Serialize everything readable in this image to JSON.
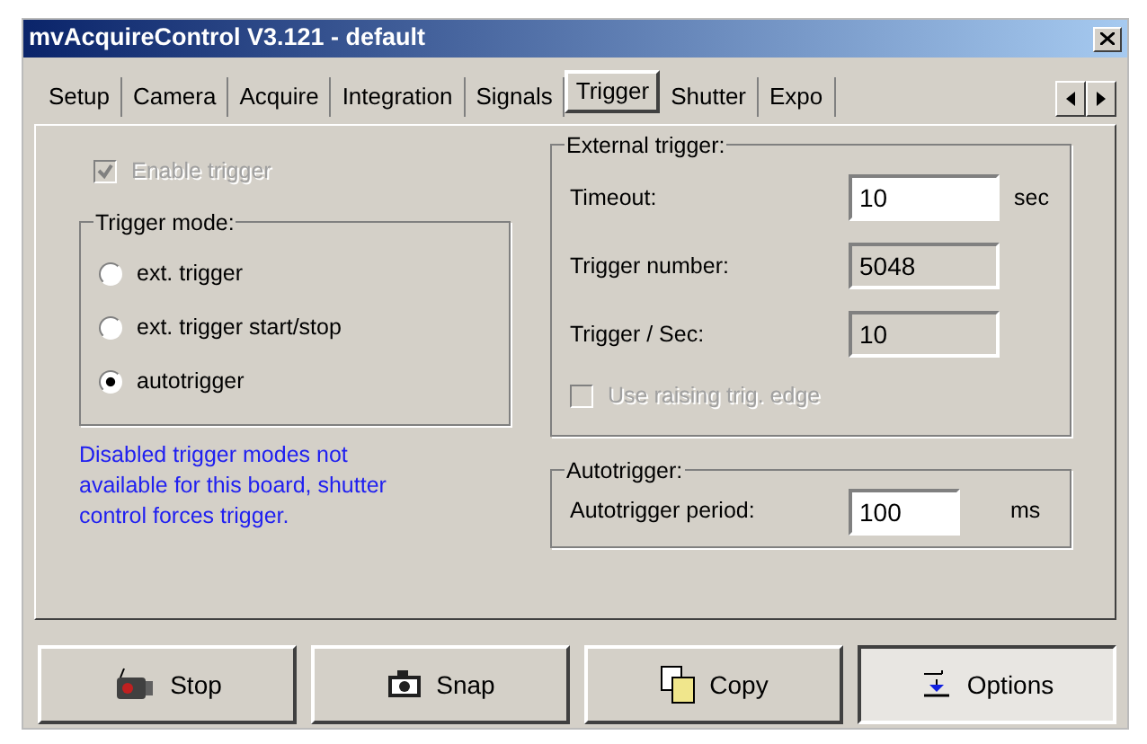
{
  "window": {
    "title": "mvAcquireControl  V3.121 - default"
  },
  "tabs": [
    {
      "label": "Setup",
      "selected": false
    },
    {
      "label": "Camera",
      "selected": false
    },
    {
      "label": "Acquire",
      "selected": false
    },
    {
      "label": "Integration",
      "selected": false
    },
    {
      "label": "Signals",
      "selected": false
    },
    {
      "label": "Trigger",
      "selected": true
    },
    {
      "label": "Shutter",
      "selected": false
    },
    {
      "label": "Expo",
      "selected": false
    }
  ],
  "enable_trigger": {
    "label": "Enable trigger",
    "checked": true,
    "disabled": true
  },
  "trigger_mode": {
    "title": "Trigger mode:",
    "options": [
      {
        "label": "ext. trigger",
        "selected": false
      },
      {
        "label": "ext. trigger start/stop",
        "selected": false
      },
      {
        "label": "autotrigger",
        "selected": true
      }
    ]
  },
  "note": "Disabled trigger modes not available for this board, shutter control forces trigger.",
  "external_trigger": {
    "title": "External trigger:",
    "fields": [
      {
        "label": "Timeout:",
        "value": "10",
        "unit": "sec",
        "disabled": false
      },
      {
        "label": "Trigger number:",
        "value": "5048",
        "disabled": true
      },
      {
        "label": "Trigger / Sec:",
        "value": "10",
        "disabled": true
      }
    ],
    "raising_edge": {
      "label": "Use raising trig. edge",
      "checked": false,
      "disabled": true
    }
  },
  "autotrigger": {
    "title": "Autotrigger:",
    "field": {
      "label": "Autotrigger period:",
      "value": "100",
      "unit": "ms"
    }
  },
  "buttons": [
    {
      "kind": "stop",
      "label": "Stop",
      "pressed": false
    },
    {
      "kind": "snap",
      "label": "Snap",
      "pressed": false
    },
    {
      "kind": "copy",
      "label": "Copy",
      "pressed": false
    },
    {
      "kind": "options",
      "label": "Options",
      "pressed": true
    }
  ]
}
